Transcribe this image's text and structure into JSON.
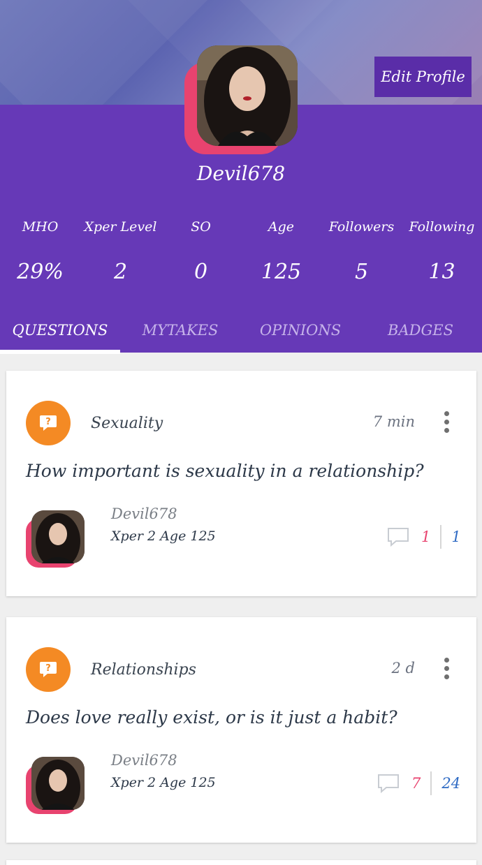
{
  "profile": {
    "edit_button": "Edit Profile",
    "username": "Devil678"
  },
  "stats": [
    {
      "label": "MHO",
      "value": "29%"
    },
    {
      "label": "Xper Level",
      "value": "2"
    },
    {
      "label": "SO",
      "value": "0"
    },
    {
      "label": "Age",
      "value": "125"
    },
    {
      "label": "Followers",
      "value": "5"
    },
    {
      "label": "Following",
      "value": "13"
    }
  ],
  "tabs": [
    {
      "label": "QUESTIONS",
      "active": true
    },
    {
      "label": "MYTAKES",
      "active": false
    },
    {
      "label": "OPINIONS",
      "active": false
    },
    {
      "label": "BADGES",
      "active": false
    }
  ],
  "posts": [
    {
      "category": "Sexuality",
      "time": "7 min",
      "question": "How important is sexuality in a relationship?",
      "author": "Devil678",
      "author_meta": "Xper 2 Age 125",
      "opinions": "1",
      "votes": "1"
    },
    {
      "category": "Relationships",
      "time": "2 d",
      "question": "Does love really exist, or is it just a habit?",
      "author": "Devil678",
      "author_meta": "Xper 2 Age 125",
      "opinions": "7",
      "votes": "24"
    }
  ],
  "colors": {
    "header_purple": "#6639b7",
    "accent_pink": "#e8436f",
    "category_orange": "#f48a24",
    "vote_blue": "#2f6bc4"
  },
  "icons": {
    "category": "question-bubble-icon",
    "menu": "more-vert-icon",
    "comments": "comment-bubble-icon"
  }
}
